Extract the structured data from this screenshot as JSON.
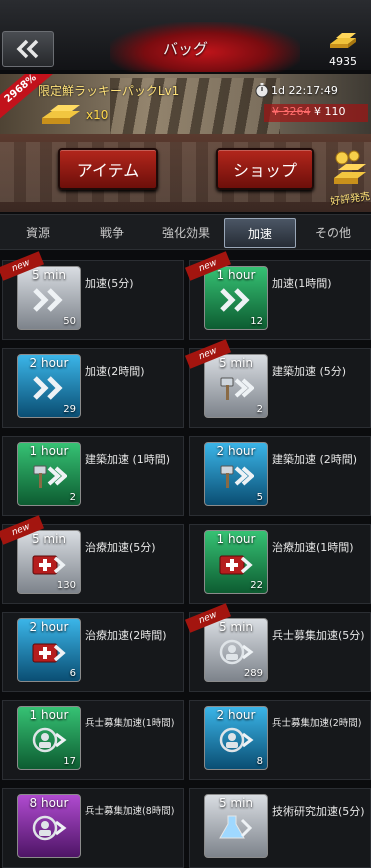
{
  "header": {
    "title": "バッグ",
    "gold": "4935"
  },
  "banner": {
    "discount": "2968%",
    "title": "限定鮮ラッキーパックLv1",
    "quantity": "x10",
    "timer": "1d 22:17:49",
    "old_price": "¥ 3264",
    "new_price": "¥ 110"
  },
  "actions": {
    "item_label": "アイテム",
    "shop_label": "ショップ",
    "sale_tag": "好評発売"
  },
  "tabs": [
    {
      "label": "資源"
    },
    {
      "label": "戦争"
    },
    {
      "label": "強化効果"
    },
    {
      "label": "加速"
    },
    {
      "label": "その他"
    }
  ],
  "active_tab": "加速",
  "items": [
    {
      "duration": "5 min",
      "name": "加速(5分)",
      "count": "50",
      "color": "gray",
      "icon": "chevron-icon",
      "new": true
    },
    {
      "duration": "1 hour",
      "name": "加速(1時間)",
      "count": "12",
      "color": "green",
      "icon": "chevron-icon",
      "new": true
    },
    {
      "duration": "2 hour",
      "name": "加速(2時間)",
      "count": "29",
      "color": "blue",
      "icon": "chevron-icon",
      "new": false
    },
    {
      "duration": "5 min",
      "name": "建築加速 (5分)",
      "count": "2",
      "color": "gray",
      "icon": "hammer-icon",
      "new": true
    },
    {
      "duration": "1 hour",
      "name": "建築加速 (1時間)",
      "count": "2",
      "color": "green",
      "icon": "hammer-icon",
      "new": false
    },
    {
      "duration": "2 hour",
      "name": "建築加速 (2時間)",
      "count": "5",
      "color": "blue",
      "icon": "hammer-icon",
      "new": false
    },
    {
      "duration": "5 min",
      "name": "治療加速(5分)",
      "count": "130",
      "color": "gray",
      "icon": "medkit-icon",
      "new": true
    },
    {
      "duration": "1 hour",
      "name": "治療加速(1時間)",
      "count": "22",
      "color": "green",
      "icon": "medkit-icon",
      "new": false
    },
    {
      "duration": "2 hour",
      "name": "治療加速(2時間)",
      "count": "6",
      "color": "blue",
      "icon": "medkit-icon",
      "new": false
    },
    {
      "duration": "5 min",
      "name": "兵士募集加速(5分)",
      "count": "289",
      "color": "gray",
      "icon": "soldier-icon",
      "new": true
    },
    {
      "duration": "1 hour",
      "name": "兵士募集加速(1時間)",
      "count": "17",
      "color": "green",
      "icon": "soldier-icon",
      "new": false
    },
    {
      "duration": "2 hour",
      "name": "兵士募集加速(2時間)",
      "count": "8",
      "color": "blue",
      "icon": "soldier-icon",
      "new": false
    },
    {
      "duration": "8 hour",
      "name": "兵士募集加速(8時間)",
      "count": "",
      "color": "purple",
      "icon": "soldier-icon",
      "new": false
    },
    {
      "duration": "5 min",
      "name": "技術研究加速(5分)",
      "count": "",
      "color": "gray",
      "icon": "flask-icon",
      "new": false
    }
  ]
}
